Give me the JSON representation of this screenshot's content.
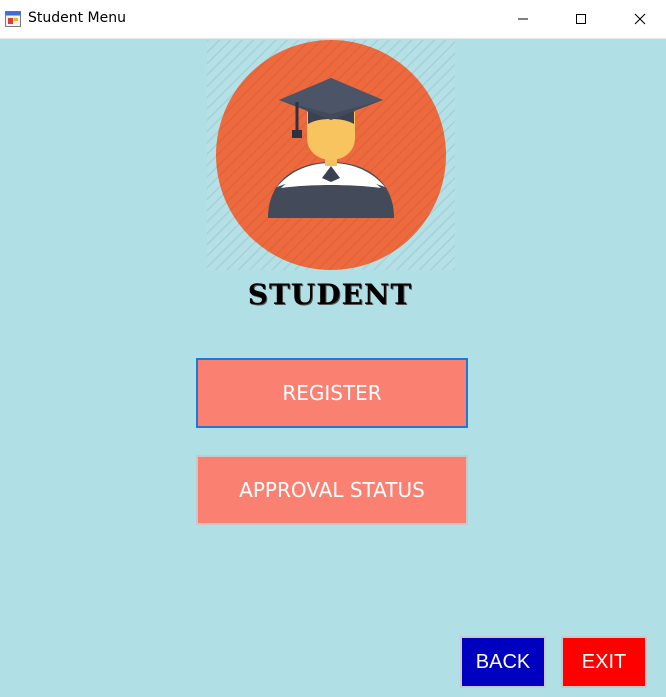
{
  "window": {
    "title": "Student Menu"
  },
  "colors": {
    "background": "#b0dfe5",
    "menu_button": "#fa8072",
    "back_button": "#0000c0",
    "exit_button": "#ff0000",
    "logo_circle": "#ec6a3e"
  },
  "header": {
    "logo_icon": "graduate-student-icon",
    "label": "STUDENT"
  },
  "menu": {
    "register_label": "REGISTER",
    "approval_label": "APPROVAL STATUS"
  },
  "footer": {
    "back_label": "BACK",
    "exit_label": "EXIT"
  }
}
